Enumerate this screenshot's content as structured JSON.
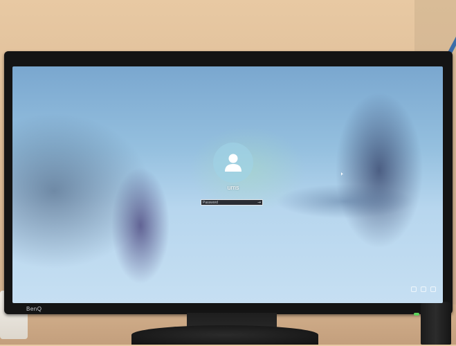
{
  "lock_screen": {
    "username": "ums",
    "password_placeholder": "Password",
    "submit_arrow": "→"
  },
  "monitor": {
    "brand": "BenQ"
  },
  "colors": {
    "password_box_bg": "#2a2d33",
    "power_led": "#5fd35c"
  },
  "icons": {
    "avatar": "user-icon",
    "submit": "arrow-right-icon",
    "tray": [
      "accessibility-icon",
      "network-icon",
      "power-icon"
    ]
  }
}
